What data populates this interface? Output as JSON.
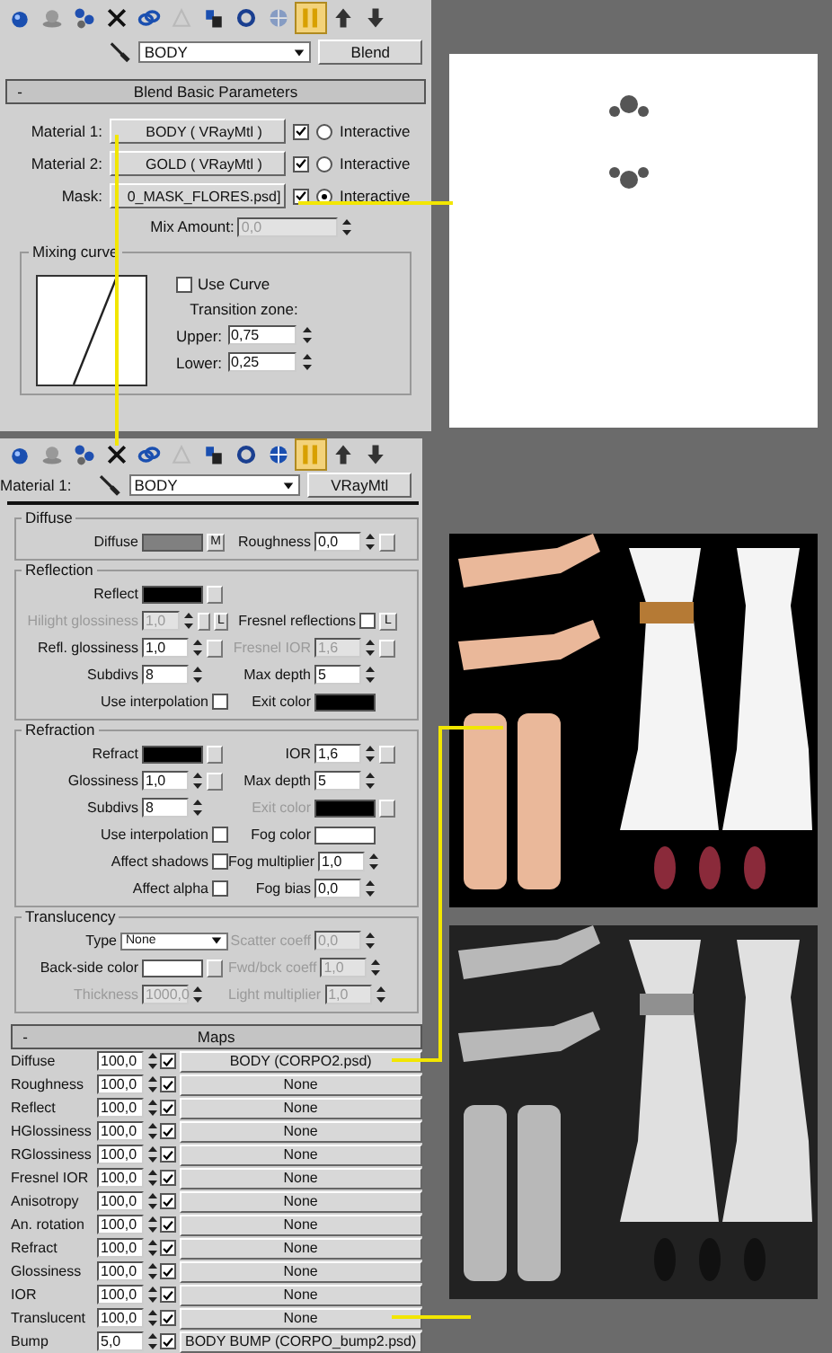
{
  "blend_panel": {
    "toolbar": [
      {
        "kind": "sphere",
        "selected": false,
        "disabled": false
      },
      {
        "kind": "sphere-plate",
        "selected": false,
        "disabled": false
      },
      {
        "kind": "spheres",
        "selected": false,
        "disabled": false
      },
      {
        "kind": "cross",
        "selected": false,
        "disabled": false
      },
      {
        "kind": "chain",
        "selected": false,
        "disabled": false
      },
      {
        "kind": "cone",
        "selected": false,
        "disabled": true
      },
      {
        "kind": "bottle",
        "selected": false,
        "disabled": false
      },
      {
        "kind": "ring",
        "selected": false,
        "disabled": false
      },
      {
        "kind": "globe",
        "selected": false,
        "disabled": true
      },
      {
        "kind": "pipes",
        "selected": true,
        "disabled": false
      },
      {
        "kind": "arrow-up",
        "selected": false,
        "disabled": false
      },
      {
        "kind": "arrow-down",
        "selected": false,
        "disabled": false
      }
    ],
    "material_name": "BODY",
    "type_button": "Blend",
    "rollout": {
      "sign": "-",
      "title": "Blend Basic Parameters"
    },
    "slots": [
      {
        "label": "Material 1:",
        "map": "BODY  ( VRayMtl )",
        "enabled": true,
        "interactive": false,
        "interactive_label": "Interactive"
      },
      {
        "label": "Material 2:",
        "map": "GOLD  ( VRayMtl )",
        "enabled": true,
        "interactive": false,
        "interactive_label": "Interactive"
      },
      {
        "label": "Mask:",
        "map": "0_MASK_FLORES.psd]",
        "enabled": true,
        "interactive": true,
        "interactive_label": "Interactive"
      }
    ],
    "mix_amount": {
      "label": "Mix Amount:",
      "value": "0,0",
      "disabled": true
    },
    "mixing_curve": {
      "title": "Mixing curve",
      "use_curve": {
        "label": "Use Curve",
        "checked": false
      },
      "transition_label": "Transition zone:",
      "upper": {
        "label": "Upper:",
        "value": "0,75"
      },
      "lower": {
        "label": "Lower:",
        "value": "0,25"
      }
    }
  },
  "material_panel": {
    "toolbar": [
      {
        "kind": "sphere",
        "selected": false,
        "disabled": false
      },
      {
        "kind": "sphere-plate",
        "selected": false,
        "disabled": false
      },
      {
        "kind": "spheres",
        "selected": false,
        "disabled": false
      },
      {
        "kind": "cross",
        "selected": false,
        "disabled": false
      },
      {
        "kind": "chain",
        "selected": false,
        "disabled": false
      },
      {
        "kind": "cone",
        "selected": false,
        "disabled": true
      },
      {
        "kind": "bottle",
        "selected": false,
        "disabled": false
      },
      {
        "kind": "ring",
        "selected": false,
        "disabled": false
      },
      {
        "kind": "globe",
        "selected": false,
        "disabled": false
      },
      {
        "kind": "pipes",
        "selected": true,
        "disabled": false
      },
      {
        "kind": "arrow-up",
        "selected": false,
        "disabled": false
      },
      {
        "kind": "arrow-down",
        "selected": false,
        "disabled": false
      }
    ],
    "slot_label": "Material 1:",
    "material_name": "BODY",
    "type_button": "VRayMtl",
    "groups": [
      {
        "title": "Diffuse",
        "rows": [
          {
            "left": {
              "kind": "swatch",
              "label": "Diffuse",
              "color": "#808080",
              "button_text": "M",
              "disabled": false
            },
            "right": {
              "kind": "spinner",
              "label": "Roughness",
              "value": "0,0",
              "map": true,
              "disabled": false
            }
          }
        ]
      },
      {
        "title": "Reflection",
        "rows": [
          {
            "left": {
              "kind": "swatch",
              "label": "Reflect",
              "color": "#000000",
              "map": true,
              "disabled": false
            }
          },
          {
            "left": {
              "kind": "spinner",
              "label": "Hilight glossiness",
              "value": "1,0",
              "map": true,
              "button_text": "L",
              "disabled": true
            },
            "right": {
              "kind": "check",
              "label": "Fresnel reflections",
              "checked": false,
              "button_text": "L",
              "disabled": false
            }
          },
          {
            "left": {
              "kind": "spinner",
              "label": "Refl. glossiness",
              "value": "1,0",
              "map": true,
              "disabled": false
            },
            "right": {
              "kind": "spinner",
              "label": "Fresnel IOR",
              "value": "1,6",
              "map": true,
              "disabled": true
            }
          },
          {
            "left": {
              "kind": "spinner",
              "label": "Subdivs",
              "value": "8",
              "disabled": false
            },
            "right": {
              "kind": "spinner",
              "label": "Max depth",
              "value": "5",
              "disabled": false
            }
          },
          {
            "left": {
              "kind": "check",
              "label": "Use interpolation",
              "checked": false,
              "disabled": false
            },
            "right": {
              "kind": "swatch",
              "label": "Exit color",
              "color": "#000000",
              "disabled": false
            }
          }
        ]
      },
      {
        "title": "Refraction",
        "rows": [
          {
            "left": {
              "kind": "swatch",
              "label": "Refract",
              "color": "#000000",
              "map": true,
              "disabled": false
            },
            "right": {
              "kind": "spinner",
              "label": "IOR",
              "value": "1,6",
              "map": true,
              "disabled": false
            }
          },
          {
            "left": {
              "kind": "spinner",
              "label": "Glossiness",
              "value": "1,0",
              "map": true,
              "disabled": false
            },
            "right": {
              "kind": "spinner",
              "label": "Max depth",
              "value": "5",
              "disabled": false
            }
          },
          {
            "left": {
              "kind": "spinner",
              "label": "Subdivs",
              "value": "8",
              "disabled": false
            },
            "right": {
              "kind": "swatch",
              "label": "Exit color",
              "color": "#000000",
              "map": true,
              "disabled": true
            }
          },
          {
            "left": {
              "kind": "check",
              "label": "Use interpolation",
              "checked": false,
              "disabled": false
            },
            "right": {
              "kind": "swatch",
              "label": "Fog color",
              "color": "#ffffff",
              "disabled": false
            }
          },
          {
            "left": {
              "kind": "check",
              "label": "Affect shadows",
              "checked": false,
              "disabled": false
            },
            "right": {
              "kind": "spinner",
              "label": "Fog multiplier",
              "value": "1,0",
              "disabled": false
            }
          },
          {
            "left": {
              "kind": "check",
              "label": "Affect alpha",
              "checked": false,
              "disabled": false
            },
            "right": {
              "kind": "spinner",
              "label": "Fog bias",
              "value": "0,0",
              "disabled": false
            }
          }
        ]
      },
      {
        "title": "Translucency",
        "rows": [
          {
            "left": {
              "kind": "dropdown",
              "label": "Type",
              "value": "None",
              "disabled": false
            },
            "right": {
              "kind": "spinner",
              "label": "Scatter coeff",
              "value": "0,0",
              "disabled": true
            }
          },
          {
            "left": {
              "kind": "swatch",
              "label": "Back-side color",
              "color": "#ffffff",
              "map": true,
              "disabled": false
            },
            "right": {
              "kind": "spinner",
              "label": "Fwd/bck coeff",
              "value": "1,0",
              "disabled": true
            }
          },
          {
            "left": {
              "kind": "spinner",
              "label": "Thickness",
              "value": "1000,0",
              "disabled": true
            },
            "right": {
              "kind": "spinner",
              "label": "Light multiplier",
              "value": "1,0",
              "disabled": true
            }
          }
        ]
      }
    ],
    "maps": {
      "sign": "-",
      "title": "Maps",
      "rows": [
        {
          "label": "Diffuse",
          "amount": "100,0",
          "checked": true,
          "map": "BODY (CORPO2.psd)"
        },
        {
          "label": "Roughness",
          "amount": "100,0",
          "checked": true,
          "map": "None"
        },
        {
          "label": "Reflect",
          "amount": "100,0",
          "checked": true,
          "map": "None"
        },
        {
          "label": "HGlossiness",
          "amount": "100,0",
          "checked": true,
          "map": "None"
        },
        {
          "label": "RGlossiness",
          "amount": "100,0",
          "checked": true,
          "map": "None"
        },
        {
          "label": "Fresnel IOR",
          "amount": "100,0",
          "checked": true,
          "map": "None"
        },
        {
          "label": "Anisotropy",
          "amount": "100,0",
          "checked": true,
          "map": "None"
        },
        {
          "label": "An. rotation",
          "amount": "100,0",
          "checked": true,
          "map": "None"
        },
        {
          "label": "Refract",
          "amount": "100,0",
          "checked": true,
          "map": "None"
        },
        {
          "label": "Glossiness",
          "amount": "100,0",
          "checked": true,
          "map": "None"
        },
        {
          "label": "IOR",
          "amount": "100,0",
          "checked": true,
          "map": "None"
        },
        {
          "label": "Translucent",
          "amount": "100,0",
          "checked": true,
          "map": "None"
        },
        {
          "label": "Bump",
          "amount": "5,0",
          "checked": true,
          "map": "BODY BUMP (CORPO_bump2.psd)"
        }
      ]
    }
  }
}
